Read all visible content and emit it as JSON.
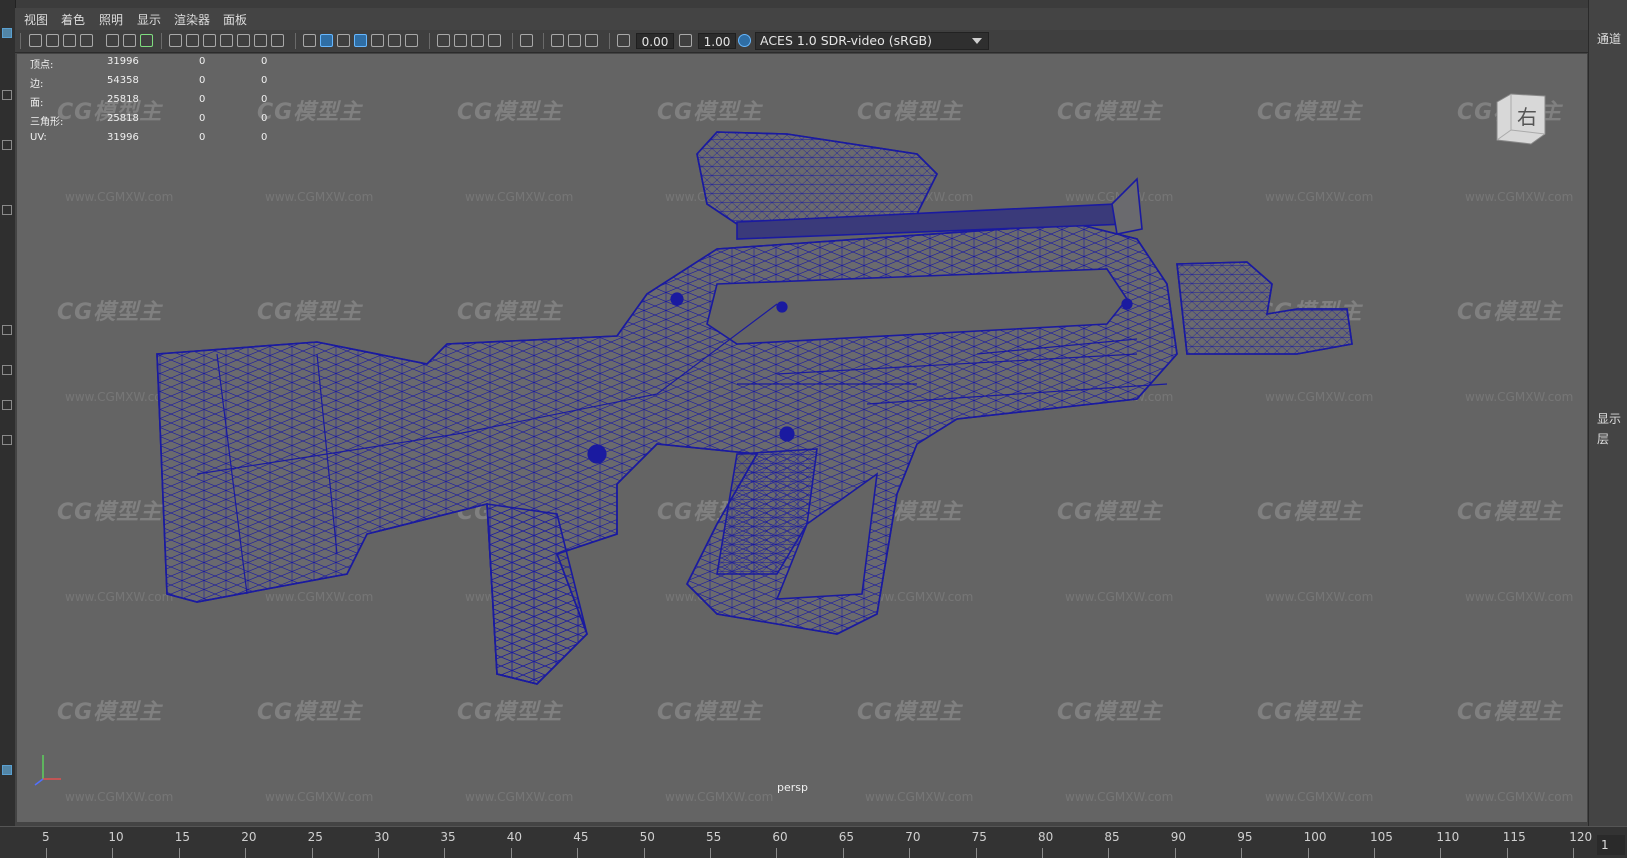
{
  "menu": {
    "items": [
      "视图",
      "着色",
      "照明",
      "显示",
      "渲染器",
      "面板"
    ]
  },
  "toolbar": {
    "exposure_value": "0.00",
    "gamma_value": "1.00",
    "color_space": "ACES 1.0 SDR-video (sRGB)",
    "icons": [
      "select-camera-icon",
      "camera-attributes-icon",
      "bookmark-icon",
      "image-plane-icon",
      "grid-icon",
      "film-gate-icon",
      "resolution-gate-icon",
      "safe-action-icon",
      "wireframe-icon",
      "smooth-shade-icon",
      "default-material-icon",
      "textured-icon",
      "lighting-icon",
      "shadows-icon",
      "xray-icon",
      "isolate-select-icon",
      "exposure-icon",
      "gamma-icon",
      "color-management-icon"
    ]
  },
  "hud": {
    "rows": [
      {
        "label": "顶点:",
        "v1": "31996",
        "v2": "0",
        "v3": "0"
      },
      {
        "label": "边:",
        "v1": "54358",
        "v2": "0",
        "v3": "0"
      },
      {
        "label": "面:",
        "v1": "25818",
        "v2": "0",
        "v3": "0"
      },
      {
        "label": "三角形:",
        "v1": "25818",
        "v2": "0",
        "v3": "0"
      },
      {
        "label": "UV:",
        "v1": "31996",
        "v2": "0",
        "v3": "0"
      }
    ]
  },
  "viewcube": {
    "face_label": "右"
  },
  "viewport": {
    "camera": "persp",
    "watermark_text": "CG模型主",
    "watermark_url": "www.CGMXW.com",
    "wire_color": "#1a1aa0",
    "background_color": "#646464"
  },
  "right_panel": {
    "labels": [
      "通道",
      "显示",
      "层"
    ]
  },
  "timeline": {
    "ticks": [
      "5",
      "10",
      "15",
      "20",
      "25",
      "30",
      "35",
      "40",
      "45",
      "50",
      "55",
      "60",
      "65",
      "70",
      "75",
      "80",
      "85",
      "90",
      "95",
      "100",
      "105",
      "110",
      "115",
      "120"
    ],
    "current_frame": "1"
  }
}
